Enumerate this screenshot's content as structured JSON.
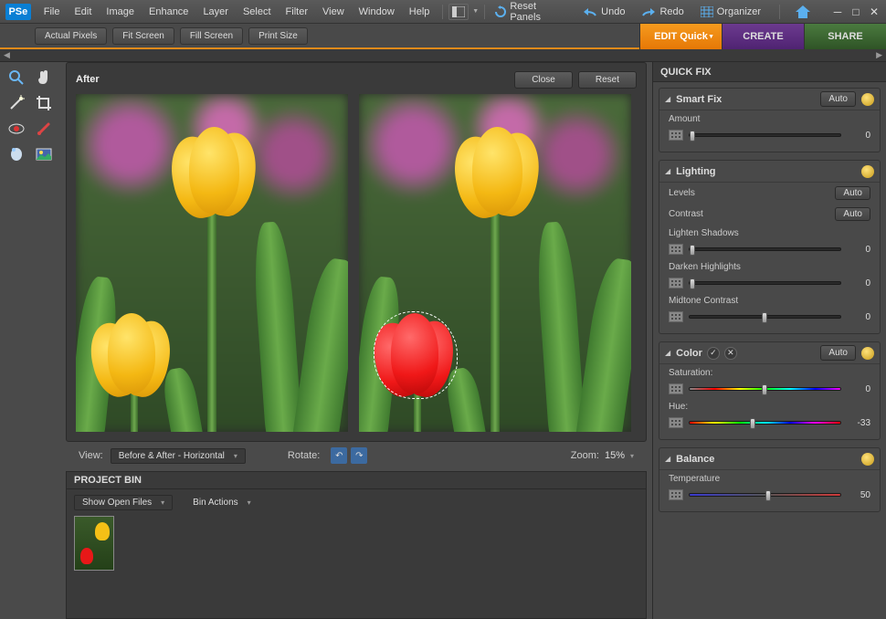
{
  "app": {
    "logo": "PSe"
  },
  "menu": [
    "File",
    "Edit",
    "Image",
    "Enhance",
    "Layer",
    "Select",
    "Filter",
    "View",
    "Window",
    "Help"
  ],
  "topButtons": {
    "reset_panels": "Reset Panels",
    "undo": "Undo",
    "redo": "Redo",
    "organizer": "Organizer"
  },
  "optionsBar": {
    "actual_pixels": "Actual Pixels",
    "fit_screen": "Fit Screen",
    "fill_screen": "Fill Screen",
    "print_size": "Print Size"
  },
  "modes": {
    "edit": "EDIT Quick",
    "create": "CREATE",
    "share": "SHARE"
  },
  "canvas": {
    "title": "After",
    "close": "Close",
    "reset": "Reset"
  },
  "viewbar": {
    "view_label": "View:",
    "view_value": "Before & After - Horizontal",
    "rotate_label": "Rotate:",
    "zoom_label": "Zoom:",
    "zoom_value": "15%"
  },
  "projectBin": {
    "header": "PROJECT BIN",
    "show_open": "Show Open Files",
    "bin_actions": "Bin Actions"
  },
  "rpanel": {
    "header": "QUICK FIX",
    "smartfix": {
      "title": "Smart Fix",
      "auto": "Auto",
      "amount": "Amount",
      "amount_val": "0"
    },
    "lighting": {
      "title": "Lighting",
      "levels": "Levels",
      "levels_auto": "Auto",
      "contrast": "Contrast",
      "contrast_auto": "Auto",
      "lighten": "Lighten Shadows",
      "lighten_val": "0",
      "darken": "Darken Highlights",
      "darken_val": "0",
      "midtone": "Midtone Contrast",
      "midtone_val": "0"
    },
    "color": {
      "title": "Color",
      "auto": "Auto",
      "saturation": "Saturation:",
      "sat_val": "0",
      "hue": "Hue:",
      "hue_val": "-33"
    },
    "balance": {
      "title": "Balance",
      "temperature": "Temperature",
      "temp_val": "50"
    }
  }
}
